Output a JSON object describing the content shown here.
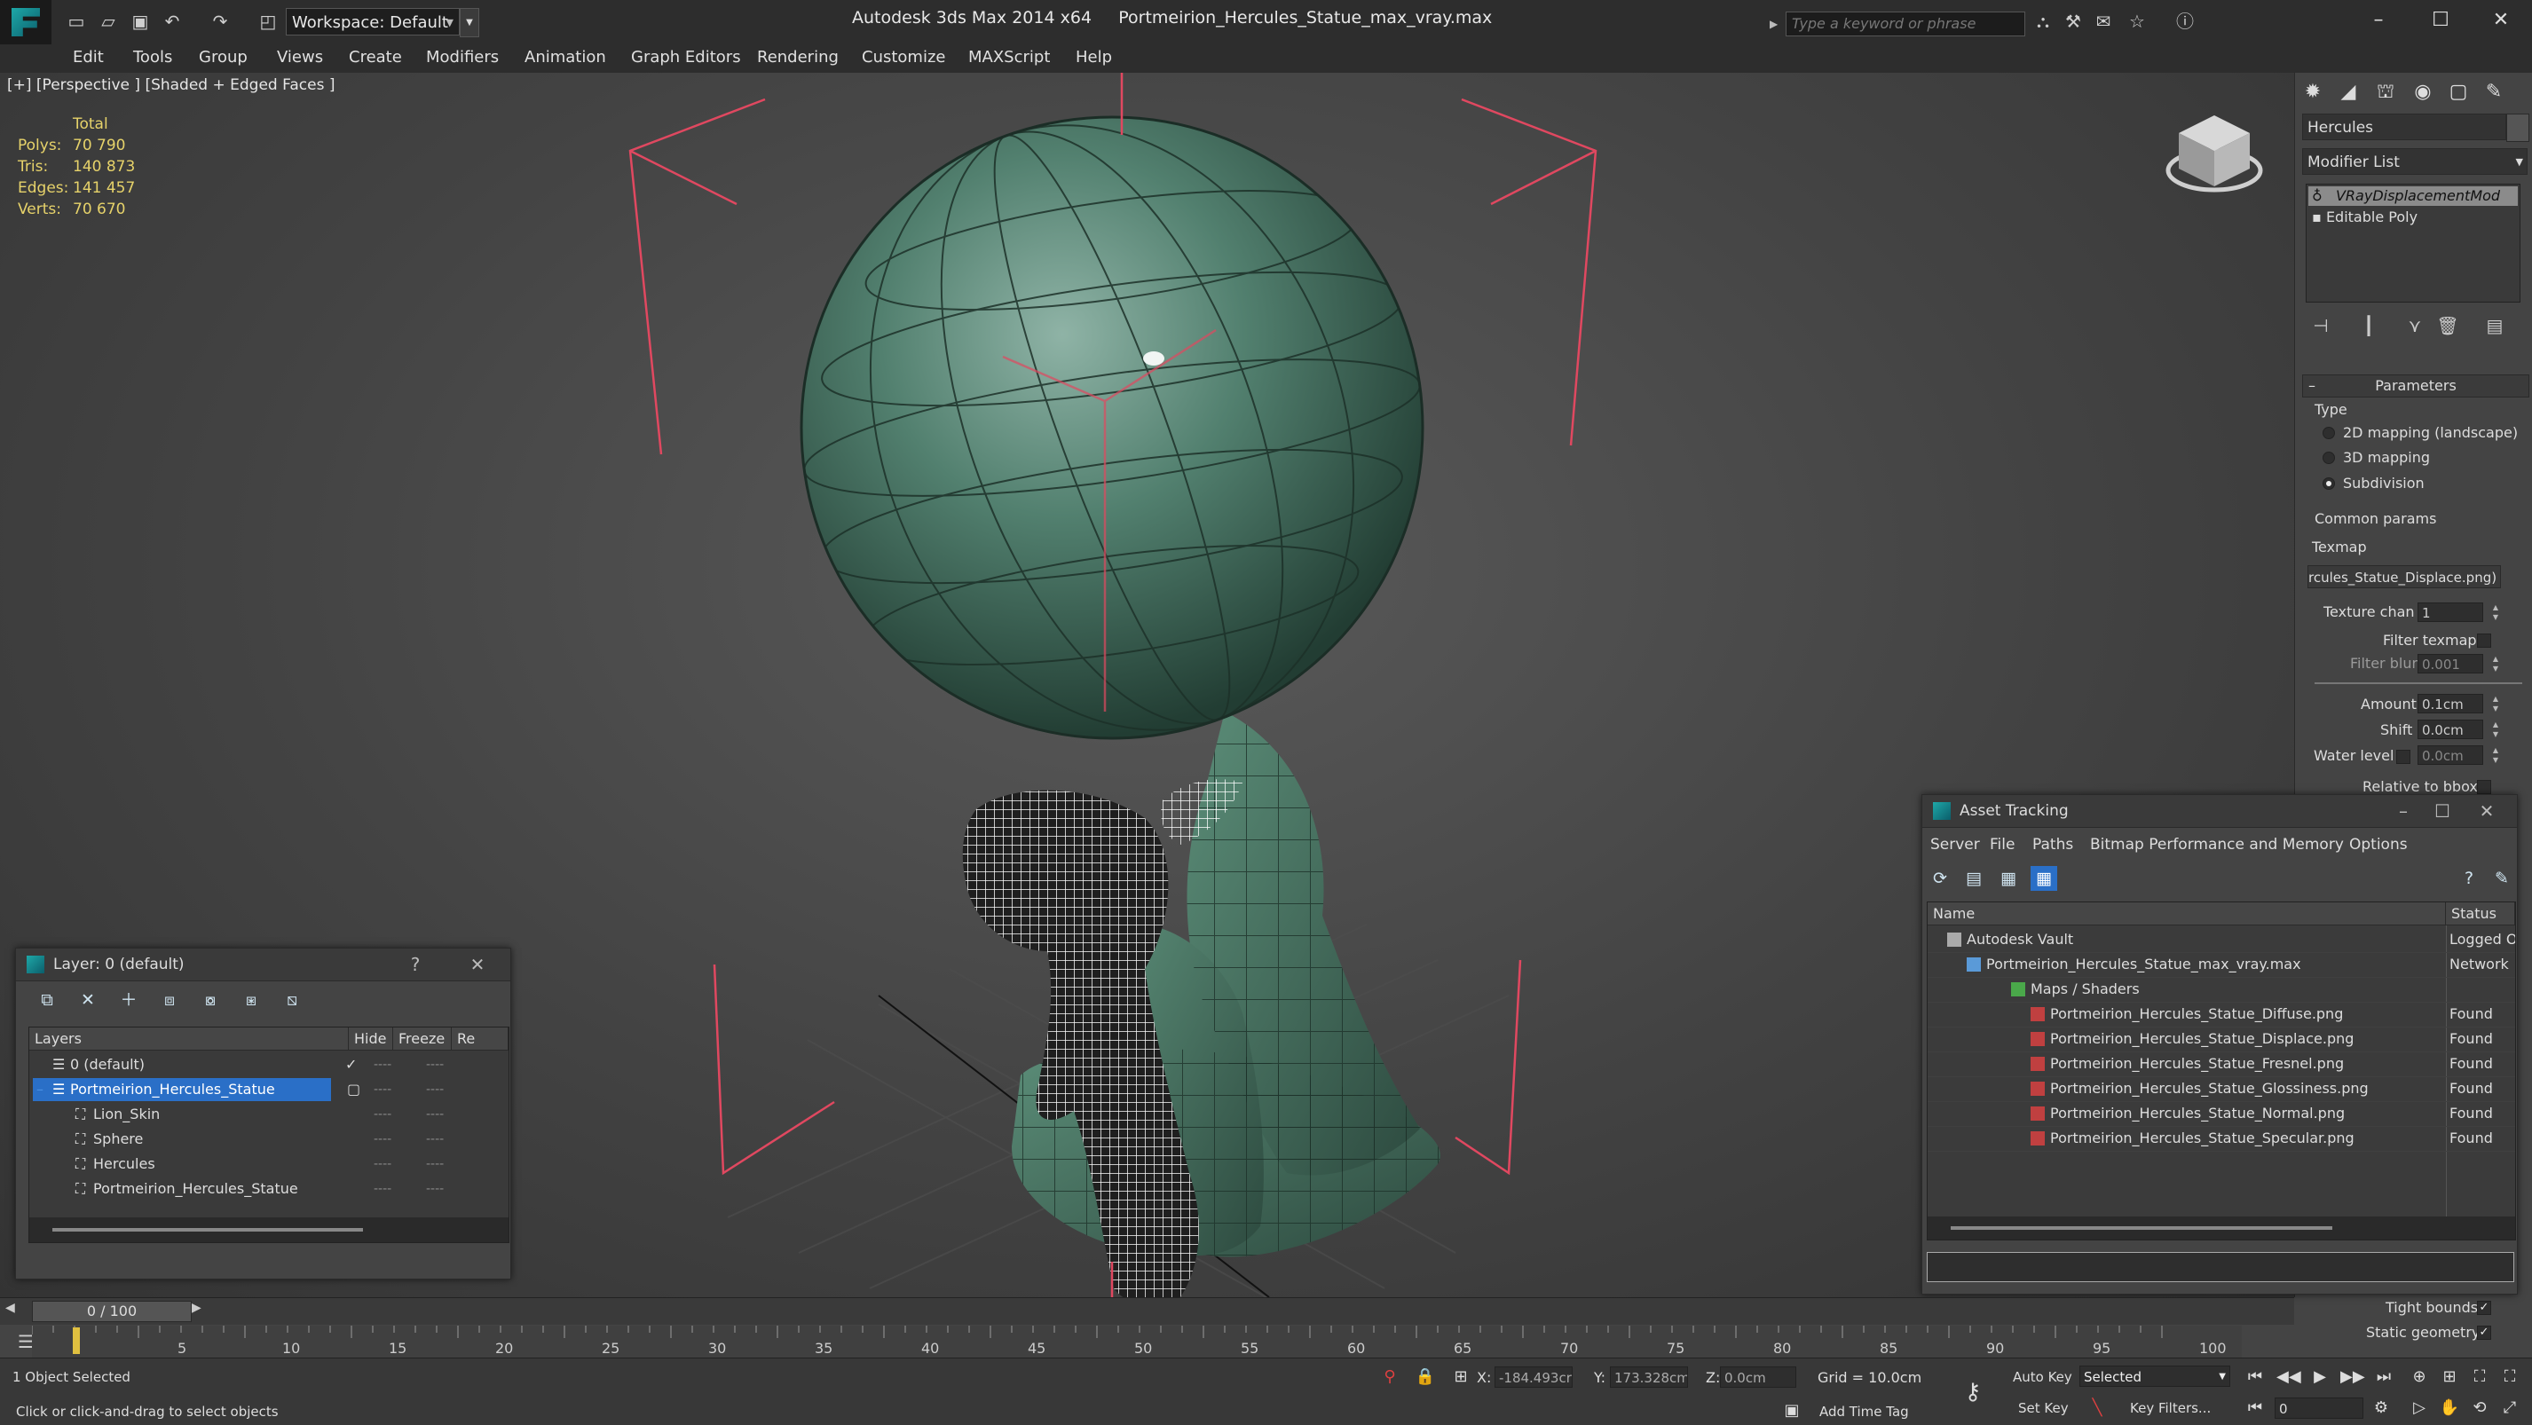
{
  "titlebar": {
    "workspace": "Workspace: Default",
    "app": "Autodesk 3ds Max  2014 x64",
    "file": "Portmeirion_Hercules_Statue_max_vray.max",
    "search_placeholder": "Type a keyword or phrase"
  },
  "menu": [
    "Edit",
    "Tools",
    "Group",
    "Views",
    "Create",
    "Modifiers",
    "Animation",
    "Graph Editors",
    "Rendering",
    "Customize",
    "MAXScript",
    "Help"
  ],
  "viewport": {
    "label": "[+] [Perspective ] [Shaded + Edged Faces ]",
    "stats_header": "Total",
    "stats": [
      {
        "label": "Polys:",
        "value": "70 790"
      },
      {
        "label": "Tris:",
        "value": "140 873"
      },
      {
        "label": "Edges:",
        "value": "141 457"
      },
      {
        "label": "Verts:",
        "value": "70 670"
      }
    ]
  },
  "command_panel": {
    "object_name": "Hercules",
    "modifier_list": "Modifier List",
    "stack": [
      "VRayDisplacementMod",
      "Editable Poly"
    ],
    "rollout": "Parameters",
    "type_label": "Type",
    "types": [
      "2D mapping (landscape)",
      "3D mapping",
      "Subdivision"
    ],
    "common_params": "Common params",
    "texmap_label": "Texmap",
    "texmap_value": "rcules_Statue_Displace.png)",
    "texture_chan_label": "Texture chan",
    "texture_chan_value": "1",
    "filter_texmap": "Filter texmap",
    "filter_blur_label": "Filter blur",
    "filter_blur_value": "0.001",
    "amount_label": "Amount",
    "amount_value": "0.1cm",
    "shift_label": "Shift",
    "shift_value": "0.0cm",
    "water_level_label": "Water level",
    "water_level_value": "0.0cm",
    "relative_to_bbox": "Relative to bbox",
    "tight_bounds": "Tight bounds",
    "static_geometry": "Static geometry"
  },
  "layer_dialog": {
    "title": "Layer: 0 (default)",
    "help": "?",
    "columns": [
      "Layers",
      "Hide",
      "Freeze",
      "Re"
    ],
    "rows": [
      {
        "name": "0 (default)"
      },
      {
        "name": "Portmeirion_Hercules_Statue"
      },
      {
        "name": "Lion_Skin"
      },
      {
        "name": "Sphere"
      },
      {
        "name": "Hercules"
      },
      {
        "name": "Portmeirion_Hercules_Statue"
      }
    ],
    "dash": "----"
  },
  "asset_dialog": {
    "title": "Asset Tracking",
    "menu": [
      "Server",
      "File",
      "Paths",
      "Bitmap Performance and Memory",
      "Options"
    ],
    "columns": [
      "Name",
      "Status"
    ],
    "rows": [
      {
        "name": "Autodesk Vault",
        "status": "Logged O"
      },
      {
        "name": "Portmeirion_Hercules_Statue_max_vray.max",
        "status": "Network"
      },
      {
        "name": "Maps / Shaders",
        "status": ""
      },
      {
        "name": "Portmeirion_Hercules_Statue_Diffuse.png",
        "status": "Found"
      },
      {
        "name": "Portmeirion_Hercules_Statue_Displace.png",
        "status": "Found"
      },
      {
        "name": "Portmeirion_Hercules_Statue_Fresnel.png",
        "status": "Found"
      },
      {
        "name": "Portmeirion_Hercules_Statue_Glossiness.png",
        "status": "Found"
      },
      {
        "name": "Portmeirion_Hercules_Statue_Normal.png",
        "status": "Found"
      },
      {
        "name": "Portmeirion_Hercules_Statue_Specular.png",
        "status": "Found"
      }
    ]
  },
  "timeline": {
    "slider": "0 / 100",
    "ticks": [
      "5",
      "10",
      "15",
      "20",
      "25",
      "30",
      "35",
      "40",
      "45",
      "50",
      "55",
      "60",
      "65",
      "70",
      "75",
      "80",
      "85",
      "90",
      "95",
      "100"
    ]
  },
  "status": {
    "selection": "1 Object Selected",
    "prompt": "Click or click-and-drag to select objects",
    "x_label": "X:",
    "x_value": "-184.493cr",
    "y_label": "Y:",
    "y_value": "173.328cm",
    "z_label": "Z:",
    "z_value": "0.0cm",
    "grid": "Grid = 10.0cm",
    "add_time_tag": "Add Time Tag",
    "auto_key": "Auto Key",
    "selected": "Selected",
    "set_key": "Set Key",
    "key_filters": "Key Filters...",
    "frame": "0"
  },
  "colors": {
    "accent": "#2a6fc7",
    "stats": "#e6d26a",
    "statue": "#4f7f6b",
    "selection_box": "#e04860"
  }
}
